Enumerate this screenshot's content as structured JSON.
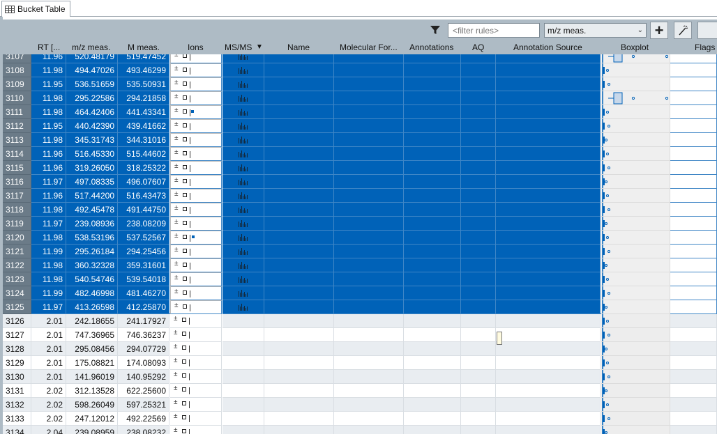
{
  "tab": {
    "label": "Bucket Table"
  },
  "toolbar": {
    "filter_placeholder": "<filter rules>",
    "column_select": "m/z meas."
  },
  "columns": [
    {
      "key": "idx",
      "label": ""
    },
    {
      "key": "rt",
      "label": "RT [..."
    },
    {
      "key": "mz",
      "label": "m/z meas."
    },
    {
      "key": "m",
      "label": "M meas."
    },
    {
      "key": "ions",
      "label": "Ions"
    },
    {
      "key": "msms",
      "label": "MS/MS"
    },
    {
      "key": "name",
      "label": "Name"
    },
    {
      "key": "formula",
      "label": "Molecular For..."
    },
    {
      "key": "annotations",
      "label": "Annotations"
    },
    {
      "key": "aq",
      "label": "AQ"
    },
    {
      "key": "source",
      "label": "Annotation Source"
    },
    {
      "key": "boxplot",
      "label": "Boxplot"
    },
    {
      "key": "flags",
      "label": "Flags"
    }
  ],
  "sort_indicator": "▼",
  "rows": [
    {
      "idx": "3107",
      "rt": "11.96",
      "mz": "520.48179",
      "m": "519.47452",
      "selected": true
    },
    {
      "idx": "3108",
      "rt": "11.98",
      "mz": "494.47026",
      "m": "493.46299",
      "selected": true
    },
    {
      "idx": "3109",
      "rt": "11.95",
      "mz": "536.51659",
      "m": "535.50931",
      "selected": true
    },
    {
      "idx": "3110",
      "rt": "11.98",
      "mz": "295.22586",
      "m": "294.21858",
      "selected": true
    },
    {
      "idx": "3111",
      "rt": "11.98",
      "mz": "464.42406",
      "m": "441.43341",
      "selected": true
    },
    {
      "idx": "3112",
      "rt": "11.95",
      "mz": "440.42390",
      "m": "439.41662",
      "selected": true
    },
    {
      "idx": "3113",
      "rt": "11.98",
      "mz": "345.31743",
      "m": "344.31016",
      "selected": true
    },
    {
      "idx": "3114",
      "rt": "11.96",
      "mz": "516.45330",
      "m": "515.44602",
      "selected": true
    },
    {
      "idx": "3115",
      "rt": "11.96",
      "mz": "319.26050",
      "m": "318.25322",
      "selected": true
    },
    {
      "idx": "3116",
      "rt": "11.97",
      "mz": "497.08335",
      "m": "496.07607",
      "selected": true
    },
    {
      "idx": "3117",
      "rt": "11.96",
      "mz": "517.44200",
      "m": "516.43473",
      "selected": true
    },
    {
      "idx": "3118",
      "rt": "11.98",
      "mz": "492.45478",
      "m": "491.44750",
      "selected": true
    },
    {
      "idx": "3119",
      "rt": "11.97",
      "mz": "239.08936",
      "m": "238.08209",
      "selected": true
    },
    {
      "idx": "3120",
      "rt": "11.98",
      "mz": "538.53196",
      "m": "537.52567",
      "selected": true
    },
    {
      "idx": "3121",
      "rt": "11.99",
      "mz": "295.26184",
      "m": "294.25456",
      "selected": true
    },
    {
      "idx": "3122",
      "rt": "11.98",
      "mz": "360.32328",
      "m": "359.31601",
      "selected": true
    },
    {
      "idx": "3123",
      "rt": "11.98",
      "mz": "540.54746",
      "m": "539.54018",
      "selected": true
    },
    {
      "idx": "3124",
      "rt": "11.99",
      "mz": "482.46998",
      "m": "481.46270",
      "selected": true
    },
    {
      "idx": "3125",
      "rt": "11.97",
      "mz": "413.26598",
      "m": "412.25870",
      "selected": true
    },
    {
      "idx": "3126",
      "rt": "2.01",
      "mz": "242.18655",
      "m": "241.17927",
      "selected": false
    },
    {
      "idx": "3127",
      "rt": "2.01",
      "mz": "747.36965",
      "m": "746.36237",
      "selected": false
    },
    {
      "idx": "3128",
      "rt": "2.01",
      "mz": "295.08456",
      "m": "294.07729",
      "selected": false
    },
    {
      "idx": "3129",
      "rt": "2.01",
      "mz": "175.08821",
      "m": "174.08093",
      "selected": false
    },
    {
      "idx": "3130",
      "rt": "2.01",
      "mz": "141.96019",
      "m": "140.95292",
      "selected": false
    },
    {
      "idx": "3131",
      "rt": "2.02",
      "mz": "312.13528",
      "m": "622.25600",
      "selected": false
    },
    {
      "idx": "3132",
      "rt": "2.02",
      "mz": "598.26049",
      "m": "597.25321",
      "selected": false
    },
    {
      "idx": "3133",
      "rt": "2.02",
      "mz": "247.12012",
      "m": "492.22569",
      "selected": false
    },
    {
      "idx": "3134",
      "rt": "2.04",
      "mz": "239.08959",
      "m": "238.08232",
      "selected": false
    }
  ],
  "colors": {
    "selection": "#0062b8",
    "header": "#aebbc5",
    "row_alt": "#e9edf1",
    "boxplot_bg": "#efefef"
  }
}
